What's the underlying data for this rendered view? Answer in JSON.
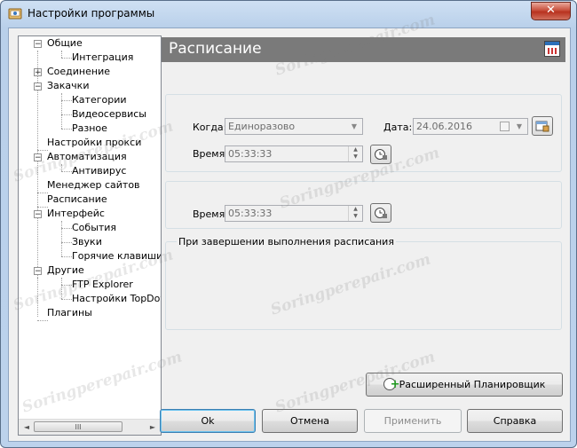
{
  "window": {
    "title": "Настройки программы",
    "close_label": "✕"
  },
  "tree": [
    {
      "label": "Общие",
      "expander": "minus"
    },
    {
      "label": "Интеграция"
    },
    {
      "label": "Соединение",
      "expander": "plus"
    },
    {
      "label": "Закачки",
      "expander": "minus"
    },
    {
      "label": "Категории"
    },
    {
      "label": "Видеосервисы"
    },
    {
      "label": "Разное"
    },
    {
      "label": "Настройки прокси"
    },
    {
      "label": "Автоматизация",
      "expander": "minus"
    },
    {
      "label": "Антивирус"
    },
    {
      "label": "Менеджер сайтов"
    },
    {
      "label": "Расписание"
    },
    {
      "label": "Интерфейс",
      "expander": "minus"
    },
    {
      "label": "События"
    },
    {
      "label": "Звуки"
    },
    {
      "label": "Горячие клавиши"
    },
    {
      "label": "Другие",
      "expander": "minus"
    },
    {
      "label": "FTP Explorer"
    },
    {
      "label": "Настройки TopDov"
    },
    {
      "label": "Плагины"
    }
  ],
  "tree_scroll": {
    "left": "◄",
    "right": "►",
    "thumb": "III"
  },
  "panel": {
    "title": "Расписание"
  },
  "start_group": {
    "when_label": "Когда:",
    "when_value": "Единоразово",
    "date_label": "Дата:",
    "date_value": "24.06.2016",
    "time_label": "Время:",
    "time_value": "05:33:33"
  },
  "end_group": {
    "time_label": "Время:",
    "time_value": "05:33:33"
  },
  "completion_group": {
    "title": "При завершении выполнения расписания"
  },
  "buttons": {
    "advanced": "Расширенный Планировщик",
    "ok": "Ok",
    "cancel": "Отмена",
    "apply": "Применить",
    "help": "Справка"
  },
  "watermark": "Soringperepair.com"
}
